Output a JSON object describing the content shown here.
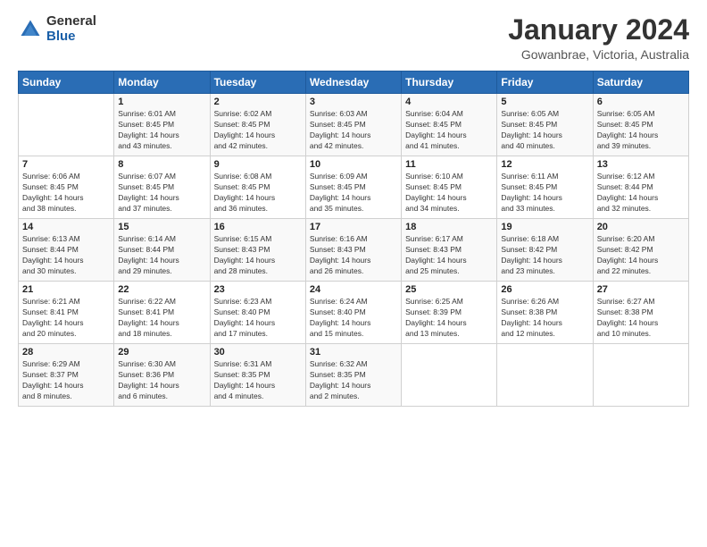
{
  "logo": {
    "general": "General",
    "blue": "Blue"
  },
  "title": "January 2024",
  "subtitle": "Gowanbrae, Victoria, Australia",
  "days_header": [
    "Sunday",
    "Monday",
    "Tuesday",
    "Wednesday",
    "Thursday",
    "Friday",
    "Saturday"
  ],
  "weeks": [
    {
      "cells": [
        {
          "day": "",
          "info": ""
        },
        {
          "day": "1",
          "info": "Sunrise: 6:01 AM\nSunset: 8:45 PM\nDaylight: 14 hours\nand 43 minutes."
        },
        {
          "day": "2",
          "info": "Sunrise: 6:02 AM\nSunset: 8:45 PM\nDaylight: 14 hours\nand 42 minutes."
        },
        {
          "day": "3",
          "info": "Sunrise: 6:03 AM\nSunset: 8:45 PM\nDaylight: 14 hours\nand 42 minutes."
        },
        {
          "day": "4",
          "info": "Sunrise: 6:04 AM\nSunset: 8:45 PM\nDaylight: 14 hours\nand 41 minutes."
        },
        {
          "day": "5",
          "info": "Sunrise: 6:05 AM\nSunset: 8:45 PM\nDaylight: 14 hours\nand 40 minutes."
        },
        {
          "day": "6",
          "info": "Sunrise: 6:05 AM\nSunset: 8:45 PM\nDaylight: 14 hours\nand 39 minutes."
        }
      ]
    },
    {
      "cells": [
        {
          "day": "7",
          "info": "Sunrise: 6:06 AM\nSunset: 8:45 PM\nDaylight: 14 hours\nand 38 minutes."
        },
        {
          "day": "8",
          "info": "Sunrise: 6:07 AM\nSunset: 8:45 PM\nDaylight: 14 hours\nand 37 minutes."
        },
        {
          "day": "9",
          "info": "Sunrise: 6:08 AM\nSunset: 8:45 PM\nDaylight: 14 hours\nand 36 minutes."
        },
        {
          "day": "10",
          "info": "Sunrise: 6:09 AM\nSunset: 8:45 PM\nDaylight: 14 hours\nand 35 minutes."
        },
        {
          "day": "11",
          "info": "Sunrise: 6:10 AM\nSunset: 8:45 PM\nDaylight: 14 hours\nand 34 minutes."
        },
        {
          "day": "12",
          "info": "Sunrise: 6:11 AM\nSunset: 8:45 PM\nDaylight: 14 hours\nand 33 minutes."
        },
        {
          "day": "13",
          "info": "Sunrise: 6:12 AM\nSunset: 8:44 PM\nDaylight: 14 hours\nand 32 minutes."
        }
      ]
    },
    {
      "cells": [
        {
          "day": "14",
          "info": "Sunrise: 6:13 AM\nSunset: 8:44 PM\nDaylight: 14 hours\nand 30 minutes."
        },
        {
          "day": "15",
          "info": "Sunrise: 6:14 AM\nSunset: 8:44 PM\nDaylight: 14 hours\nand 29 minutes."
        },
        {
          "day": "16",
          "info": "Sunrise: 6:15 AM\nSunset: 8:43 PM\nDaylight: 14 hours\nand 28 minutes."
        },
        {
          "day": "17",
          "info": "Sunrise: 6:16 AM\nSunset: 8:43 PM\nDaylight: 14 hours\nand 26 minutes."
        },
        {
          "day": "18",
          "info": "Sunrise: 6:17 AM\nSunset: 8:43 PM\nDaylight: 14 hours\nand 25 minutes."
        },
        {
          "day": "19",
          "info": "Sunrise: 6:18 AM\nSunset: 8:42 PM\nDaylight: 14 hours\nand 23 minutes."
        },
        {
          "day": "20",
          "info": "Sunrise: 6:20 AM\nSunset: 8:42 PM\nDaylight: 14 hours\nand 22 minutes."
        }
      ]
    },
    {
      "cells": [
        {
          "day": "21",
          "info": "Sunrise: 6:21 AM\nSunset: 8:41 PM\nDaylight: 14 hours\nand 20 minutes."
        },
        {
          "day": "22",
          "info": "Sunrise: 6:22 AM\nSunset: 8:41 PM\nDaylight: 14 hours\nand 18 minutes."
        },
        {
          "day": "23",
          "info": "Sunrise: 6:23 AM\nSunset: 8:40 PM\nDaylight: 14 hours\nand 17 minutes."
        },
        {
          "day": "24",
          "info": "Sunrise: 6:24 AM\nSunset: 8:40 PM\nDaylight: 14 hours\nand 15 minutes."
        },
        {
          "day": "25",
          "info": "Sunrise: 6:25 AM\nSunset: 8:39 PM\nDaylight: 14 hours\nand 13 minutes."
        },
        {
          "day": "26",
          "info": "Sunrise: 6:26 AM\nSunset: 8:38 PM\nDaylight: 14 hours\nand 12 minutes."
        },
        {
          "day": "27",
          "info": "Sunrise: 6:27 AM\nSunset: 8:38 PM\nDaylight: 14 hours\nand 10 minutes."
        }
      ]
    },
    {
      "cells": [
        {
          "day": "28",
          "info": "Sunrise: 6:29 AM\nSunset: 8:37 PM\nDaylight: 14 hours\nand 8 minutes."
        },
        {
          "day": "29",
          "info": "Sunrise: 6:30 AM\nSunset: 8:36 PM\nDaylight: 14 hours\nand 6 minutes."
        },
        {
          "day": "30",
          "info": "Sunrise: 6:31 AM\nSunset: 8:35 PM\nDaylight: 14 hours\nand 4 minutes."
        },
        {
          "day": "31",
          "info": "Sunrise: 6:32 AM\nSunset: 8:35 PM\nDaylight: 14 hours\nand 2 minutes."
        },
        {
          "day": "",
          "info": ""
        },
        {
          "day": "",
          "info": ""
        },
        {
          "day": "",
          "info": ""
        }
      ]
    }
  ]
}
